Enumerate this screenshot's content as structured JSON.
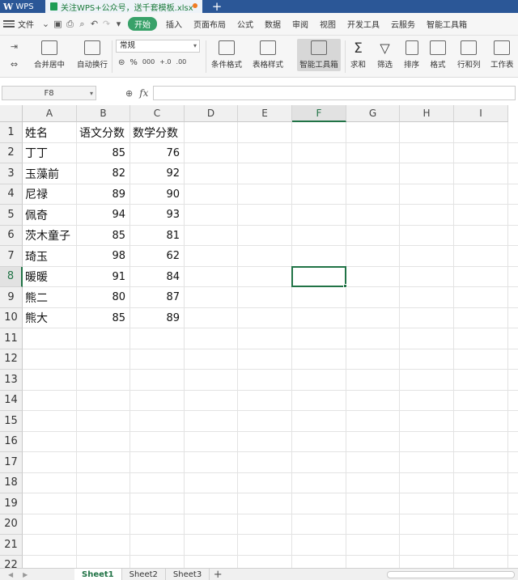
{
  "titlebar": {
    "app": "WPS",
    "doc_tab": "关注WPS+公众号，送千套模板.xlsx",
    "new_tab": "+"
  },
  "menubar": {
    "file": "文件",
    "start": "开始",
    "items": [
      "插入",
      "页面布局",
      "公式",
      "数据",
      "审阅",
      "视图",
      "开发工具",
      "云服务",
      "智能工具箱"
    ]
  },
  "ribbon": {
    "merge_center": "合并居中",
    "wrap_text": "自动换行",
    "number_format": "常规",
    "conditional_format": "条件格式",
    "table_style": "表格样式",
    "smart_toolbox": "智能工具箱",
    "sum": "求和",
    "filter": "筛选",
    "sort": "排序",
    "format": "格式",
    "row_col": "行和列",
    "worksheet": "工作表",
    "fmt_symbols": [
      "%",
      "000",
      "+.0",
      ".00"
    ]
  },
  "formula_bar": {
    "name_box": "F8",
    "fx_label": "fx",
    "value": ""
  },
  "grid": {
    "columns": [
      "A",
      "B",
      "C",
      "D",
      "E",
      "F",
      "G",
      "H",
      "I"
    ],
    "selected_column": "F",
    "row_numbers": [
      "1",
      "2",
      "3",
      "4",
      "5",
      "6",
      "7",
      "8",
      "9",
      "10",
      "11",
      "12",
      "13",
      "14",
      "15",
      "16",
      "17",
      "18",
      "19",
      "20",
      "21",
      "22"
    ],
    "selected_row": "8",
    "header": [
      "姓名",
      "语文分数",
      "数学分数"
    ],
    "rows": [
      [
        "丁丁",
        "85",
        "76"
      ],
      [
        "玉藻前",
        "82",
        "92"
      ],
      [
        "尼禄",
        "89",
        "90"
      ],
      [
        "佩奇",
        "94",
        "93"
      ],
      [
        "茨木童子",
        "85",
        "81"
      ],
      [
        "琦玉",
        "98",
        "62"
      ],
      [
        "暖暖",
        "91",
        "84"
      ],
      [
        "熊二",
        "80",
        "87"
      ],
      [
        "熊大",
        "85",
        "89"
      ]
    ]
  },
  "sheets": {
    "tabs": [
      "Sheet1",
      "Sheet2",
      "Sheet3"
    ],
    "active": "Sheet1",
    "add": "+"
  },
  "colors": {
    "accent": "#217346",
    "title_bar": "#2b5797",
    "start_button": "#38a169"
  }
}
